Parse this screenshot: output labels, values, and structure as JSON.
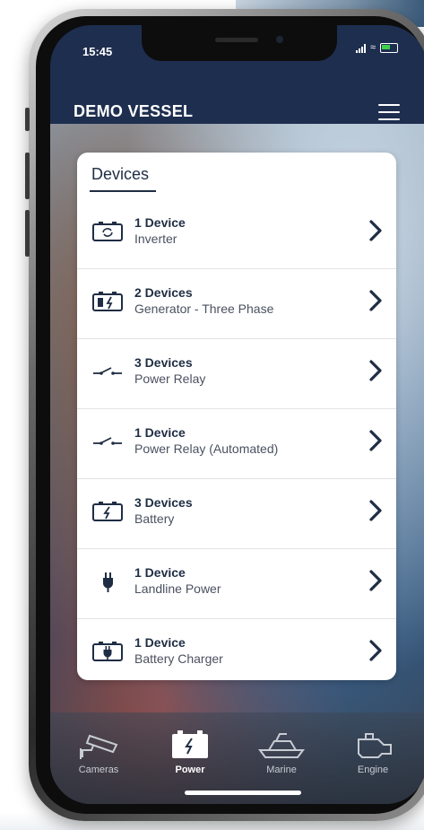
{
  "status_bar": {
    "time": "15:45"
  },
  "header": {
    "title": "DEMO VESSEL"
  },
  "devices": {
    "title": "Devices",
    "items": [
      {
        "count": "1 Device",
        "type": "Inverter",
        "icon": "inverter-icon"
      },
      {
        "count": "2 Devices",
        "type": "Generator - Three Phase",
        "icon": "generator-icon"
      },
      {
        "count": "3 Devices",
        "type": "Power Relay",
        "icon": "relay-icon"
      },
      {
        "count": "1 Device",
        "type": "Power Relay (Automated)",
        "icon": "relay-icon"
      },
      {
        "count": "3 Devices",
        "type": "Battery",
        "icon": "battery-icon"
      },
      {
        "count": "1 Device",
        "type": "Landline Power",
        "icon": "plug-icon"
      },
      {
        "count": "1 Device",
        "type": "Battery Charger",
        "icon": "battery-charger-icon"
      }
    ]
  },
  "tabbar": {
    "tabs": [
      {
        "label": "Cameras",
        "icon": "camera-icon",
        "active": false
      },
      {
        "label": "Power",
        "icon": "power-battery-icon",
        "active": true
      },
      {
        "label": "Marine",
        "icon": "boat-icon",
        "active": false
      },
      {
        "label": "Engine",
        "icon": "engine-icon",
        "active": false
      }
    ]
  },
  "colors": {
    "header_bg": "#1e2e4f",
    "text_dark": "#1f2d44",
    "card_bg": "#ffffff"
  }
}
